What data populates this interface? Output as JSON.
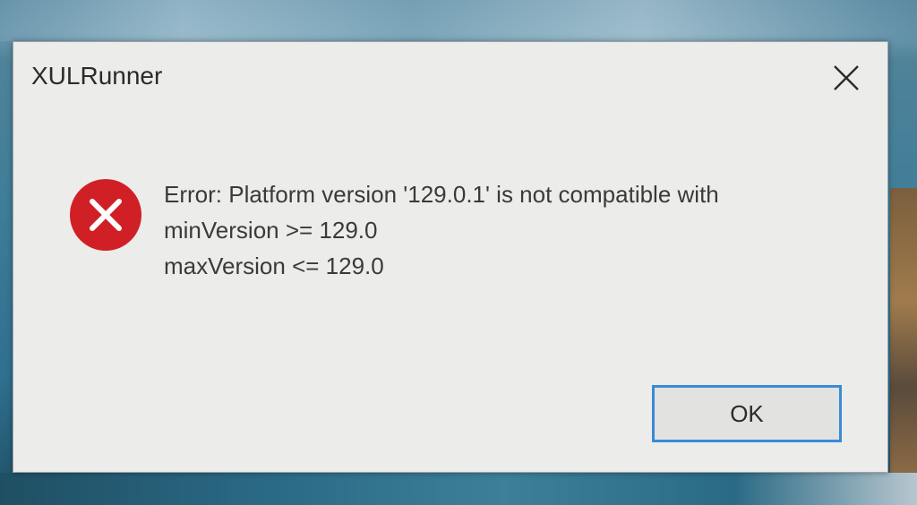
{
  "dialog": {
    "title": "XULRunner",
    "close_icon": "close-icon",
    "error_icon": "error-icon",
    "message_lines": [
      "Error: Platform version '129.0.1' is not compatible with",
      "minVersion >= 129.0",
      "maxVersion <= 129.0"
    ],
    "ok_label": "OK"
  },
  "colors": {
    "dialog_bg": "#ececea",
    "error_red": "#d11f26",
    "focus_border": "#3a8ad6"
  }
}
